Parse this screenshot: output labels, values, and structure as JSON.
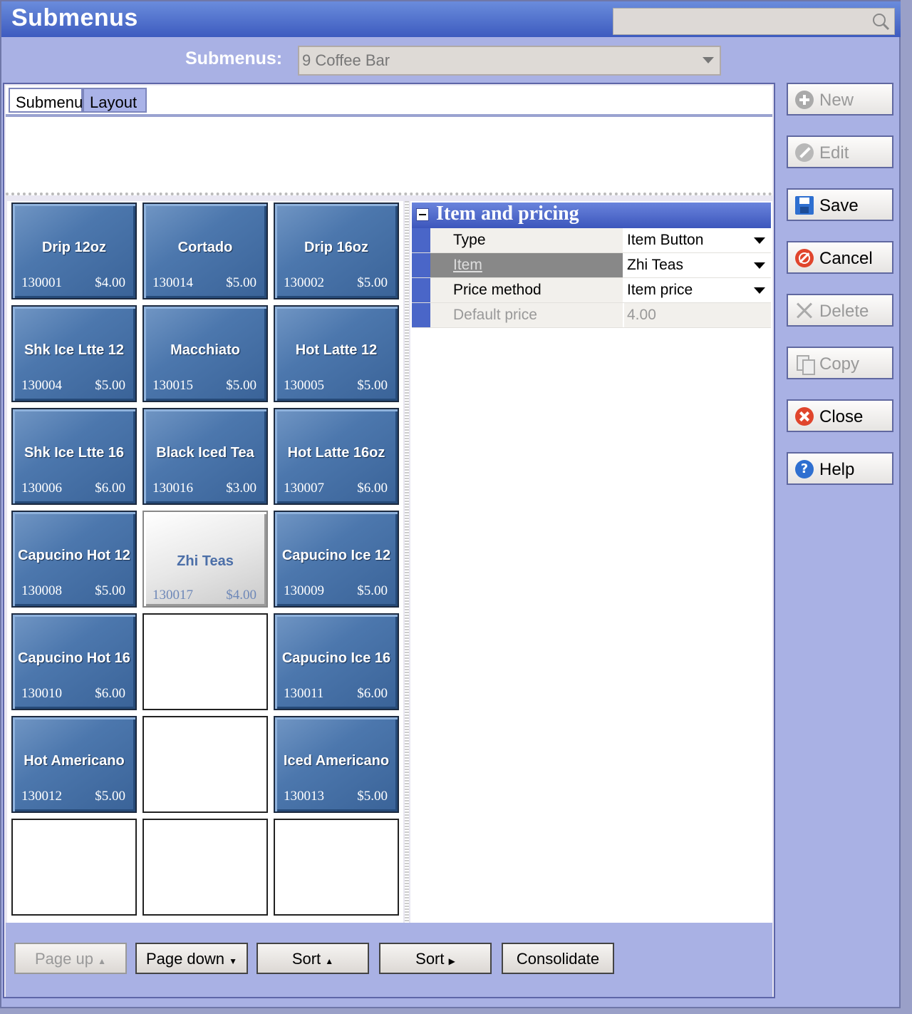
{
  "window": {
    "title": "Submenus"
  },
  "search": {
    "placeholder": ""
  },
  "submenu_selector": {
    "label": "Submenus:",
    "value": "9 Coffee Bar"
  },
  "tabs": [
    {
      "label": "Submenu"
    },
    {
      "label": "Layout"
    }
  ],
  "grid": {
    "tiles": [
      {
        "name": "Drip 12oz",
        "number": "130001",
        "price": "$4.00"
      },
      {
        "name": "Cortado",
        "number": "130014",
        "price": "$5.00"
      },
      {
        "name": "Drip 16oz",
        "number": "130002",
        "price": "$5.00"
      },
      {
        "name": "Shk Ice Ltte 12",
        "number": "130004",
        "price": "$5.00"
      },
      {
        "name": "Macchiato",
        "number": "130015",
        "price": "$5.00"
      },
      {
        "name": "Hot Latte 12",
        "number": "130005",
        "price": "$5.00"
      },
      {
        "name": "Shk Ice Ltte 16",
        "number": "130006",
        "price": "$6.00"
      },
      {
        "name": "Black Iced Tea",
        "number": "130016",
        "price": "$3.00"
      },
      {
        "name": "Hot Latte 16oz",
        "number": "130007",
        "price": "$6.00"
      },
      {
        "name": "Capucino Hot 12",
        "number": "130008",
        "price": "$5.00"
      },
      {
        "name": "Zhi Teas",
        "number": "130017",
        "price": "$4.00",
        "selected": true
      },
      {
        "name": "Capucino Ice 12",
        "number": "130009",
        "price": "$5.00"
      },
      {
        "name": "Capucino Hot 16",
        "number": "130010",
        "price": "$6.00"
      },
      {
        "name": "Capucino Ice 16",
        "number": "130011",
        "price": "$6.00"
      },
      {
        "name": "Hot Americano",
        "number": "130012",
        "price": "$5.00"
      },
      {
        "name": "Iced Americano",
        "number": "130013",
        "price": "$5.00"
      }
    ]
  },
  "properties": {
    "title": "Item and pricing",
    "rows": [
      {
        "key": "Type",
        "value": "Item Button"
      },
      {
        "key": "Item",
        "value": "Zhi Teas"
      },
      {
        "key": "Price method",
        "value": "Item price"
      },
      {
        "key": "Default price",
        "value": "4.00"
      }
    ]
  },
  "bottom_buttons": {
    "page_up": "Page up",
    "page_down": "Page down",
    "sort_1": "Sort",
    "sort_2": "Sort",
    "consolidate": "Consolidate"
  },
  "side_buttons": {
    "new": "New",
    "edit": "Edit",
    "save": "Save",
    "cancel": "Cancel",
    "delete": "Delete",
    "copy": "Copy",
    "close": "Close",
    "help": "Help",
    "help_glyph": "?"
  },
  "colors": {
    "title_bar": "#3d5bbf",
    "background": "#a9b1e4",
    "tile_blue": "#4c77ad"
  }
}
